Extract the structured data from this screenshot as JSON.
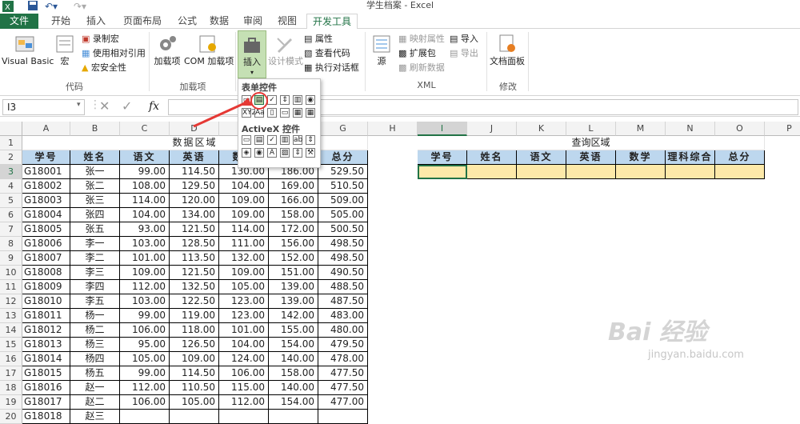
{
  "window": {
    "title": "学生档案 - Excel"
  },
  "tabs": [
    "文件",
    "开始",
    "插入",
    "页面布局",
    "公式",
    "数据",
    "审阅",
    "视图",
    "开发工具"
  ],
  "ribbon": {
    "code": {
      "group": "代码",
      "visual_basic": "Visual Basic",
      "macros": "宏",
      "record_macro": "录制宏",
      "relative_ref": "使用相对引用",
      "macro_security": "宏安全性"
    },
    "addins": {
      "group": "加载项",
      "addins": "加载项",
      "com_addins": "COM 加载项"
    },
    "controls": {
      "insert": "插入",
      "design_mode": "设计模式",
      "properties": "属性",
      "view_code": "查看代码",
      "run_dialog": "执行对话框"
    },
    "xml": {
      "group": "XML",
      "source": "源",
      "map_props": "映射属性",
      "expansion": "扩展包",
      "refresh": "刷新数据",
      "import": "导入",
      "export": "导出"
    },
    "modify": {
      "group": "修改",
      "doc_panel": "文档面板"
    }
  },
  "dropdown": {
    "form_controls": "表单控件",
    "activex_controls": "ActiveX 控件"
  },
  "formula_bar": {
    "name_box": "I3",
    "fx": "fx",
    "formula": ""
  },
  "columns": [
    "A",
    "B",
    "C",
    "D",
    "E",
    "F",
    "G",
    "H",
    "I",
    "J",
    "K",
    "L",
    "M",
    "N",
    "O",
    "P"
  ],
  "rows": [
    "1",
    "2",
    "3",
    "4",
    "5",
    "6",
    "7",
    "8",
    "9",
    "10",
    "11",
    "12",
    "13",
    "14",
    "15",
    "16",
    "17",
    "18",
    "19",
    "20"
  ],
  "sheet": {
    "data_area_title": "数据区域",
    "query_area_title": "查询区域",
    "headers": [
      "学号",
      "姓名",
      "语文",
      "英语",
      "数学",
      "理科综合",
      "总分"
    ],
    "records": [
      [
        "G18001",
        "张一",
        "99.00",
        "114.50",
        "130.00",
        "186.00",
        "529.50"
      ],
      [
        "G18002",
        "张二",
        "108.00",
        "129.50",
        "104.00",
        "169.00",
        "510.50"
      ],
      [
        "G18003",
        "张三",
        "114.00",
        "120.00",
        "109.00",
        "166.00",
        "509.00"
      ],
      [
        "G18004",
        "张四",
        "104.00",
        "134.00",
        "109.00",
        "158.00",
        "505.00"
      ],
      [
        "G18005",
        "张五",
        "93.00",
        "121.50",
        "114.00",
        "172.00",
        "500.50"
      ],
      [
        "G18006",
        "李一",
        "103.00",
        "128.50",
        "111.00",
        "156.00",
        "498.50"
      ],
      [
        "G18007",
        "李二",
        "101.00",
        "113.50",
        "132.00",
        "152.00",
        "498.50"
      ],
      [
        "G18008",
        "李三",
        "109.00",
        "121.50",
        "109.00",
        "151.00",
        "490.50"
      ],
      [
        "G18009",
        "李四",
        "112.00",
        "132.50",
        "105.00",
        "139.00",
        "488.50"
      ],
      [
        "G18010",
        "李五",
        "103.00",
        "122.50",
        "123.00",
        "139.00",
        "487.50"
      ],
      [
        "G18011",
        "杨一",
        "99.00",
        "119.00",
        "123.00",
        "142.00",
        "483.00"
      ],
      [
        "G18012",
        "杨二",
        "106.00",
        "118.00",
        "101.00",
        "155.00",
        "480.00"
      ],
      [
        "G18013",
        "杨三",
        "95.00",
        "126.50",
        "104.00",
        "154.00",
        "479.50"
      ],
      [
        "G18014",
        "杨四",
        "105.00",
        "109.00",
        "124.00",
        "140.00",
        "478.00"
      ],
      [
        "G18015",
        "杨五",
        "99.00",
        "114.50",
        "106.00",
        "158.00",
        "477.50"
      ],
      [
        "G18016",
        "赵一",
        "112.00",
        "110.50",
        "115.00",
        "140.00",
        "477.50"
      ],
      [
        "G18017",
        "赵二",
        "106.00",
        "105.00",
        "112.00",
        "154.00",
        "477.00"
      ],
      [
        "G18018",
        "赵三",
        "",
        "",
        "",
        "",
        ""
      ]
    ]
  },
  "watermark": {
    "brand": "Bai 经验",
    "url": "jingyan.baidu.com"
  },
  "colors": {
    "excel_green": "#217346",
    "header_fill": "#bdd7ee",
    "query_input_fill": "#fde9a9",
    "annotation_red": "#e53935"
  }
}
